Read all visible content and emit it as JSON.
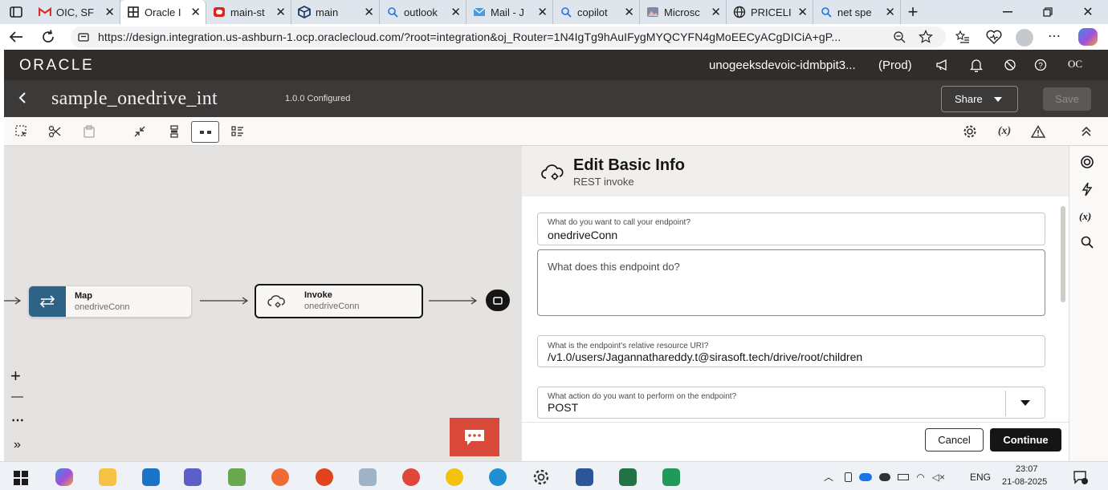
{
  "browser": {
    "tabs": [
      {
        "title": "OIC, SF",
        "active": false
      },
      {
        "title": "Oracle I",
        "active": true
      },
      {
        "title": "main-st",
        "active": false
      },
      {
        "title": "main",
        "active": false
      },
      {
        "title": "outlook",
        "active": false
      },
      {
        "title": "Mail - J",
        "active": false
      },
      {
        "title": "copilot",
        "active": false
      },
      {
        "title": "Microsc",
        "active": false
      },
      {
        "title": "PRICELI",
        "active": false
      },
      {
        "title": "net spe",
        "active": false
      }
    ],
    "url": "https://design.integration.us-ashburn-1.ocp.oraclecloud.com/?root=integration&oj_Router=1N4IgTg9hAuIFygMYQCYFN4gMoEECyACgDICiA+gP..."
  },
  "oracle": {
    "logo": "ORACLE",
    "instance": "unogeeksdevoic-idmbpit3...",
    "env": "(Prod)",
    "user_initials": "OC"
  },
  "integration": {
    "name": "sample_onedrive_int",
    "version_status": "1.0.0 Configured",
    "share_label": "Share",
    "save_label": "Save"
  },
  "canvas": {
    "nodes": [
      {
        "title": "Map",
        "subtitle": "onedriveConn"
      },
      {
        "title": "Invoke",
        "subtitle": "onedriveConn"
      }
    ],
    "zoom_in": "+",
    "zoom_out": "—",
    "more": "⋯",
    "expand": "»"
  },
  "panel": {
    "title": "Edit Basic Info",
    "subtitle": "REST invoke",
    "fields": {
      "name_label": "What do you want to call your endpoint?",
      "name_value": "onedriveConn",
      "desc_placeholder": "What does this endpoint do?",
      "uri_label": "What is the endpoint's relative resource URI?",
      "uri_value": "/v1.0/users/Jagannathareddy.t@sirasoft.tech/drive/root/children",
      "action_label": "What action do you want to perform on the endpoint?",
      "action_value": "POST"
    },
    "cancel_label": "Cancel",
    "continue_label": "Continue"
  },
  "rail": {
    "var_label": "(x)"
  },
  "toolbar": {
    "fx_label": "(x)"
  },
  "system": {
    "lang": "ENG",
    "time": "23:07",
    "date": "21-08-2025"
  },
  "colors": {
    "oracle_header": "#312d2a",
    "map_node": "#2e6386",
    "continue_button": "#161513",
    "chat_button": "#d9493a"
  }
}
